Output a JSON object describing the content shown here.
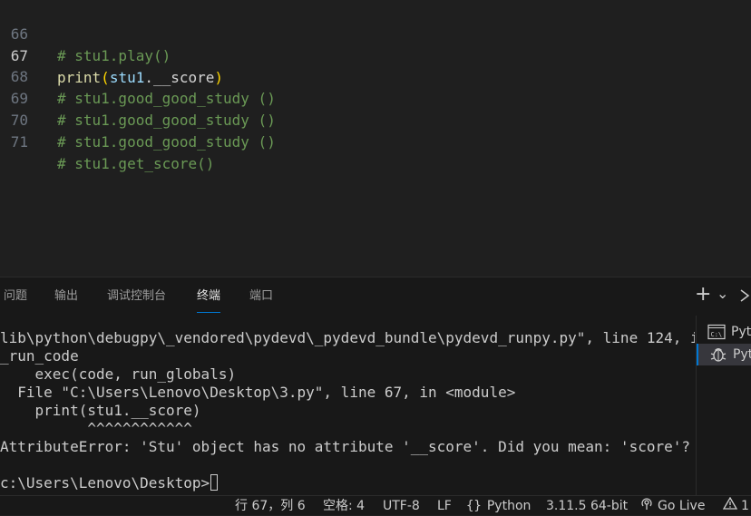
{
  "editor": {
    "lines": [
      {
        "num": "66",
        "text": "# stu1.play()"
      },
      {
        "num": "67",
        "fn": "print",
        "open": "(",
        "var": "stu1",
        "attr": ".__score",
        "close": ")"
      },
      {
        "num": "68",
        "text": "# stu1.good_good_study ()"
      },
      {
        "num": "69",
        "text": "# stu1.good_good_study ()"
      },
      {
        "num": "70",
        "text": "# stu1.good_good_study ()"
      },
      {
        "num": "71",
        "text": "# stu1.get_score()"
      }
    ]
  },
  "panel": {
    "tabs": [
      {
        "label": "问题"
      },
      {
        "label": "输出"
      },
      {
        "label": "调试控制台"
      },
      {
        "label": "终端"
      },
      {
        "label": "端口"
      }
    ],
    "active_tab": "终端",
    "actions": {
      "add": "+",
      "dropdown": "⌄"
    },
    "terminal_lines": [
      "lib\\python\\debugpy\\_vendored\\pydevd\\_pydevd_bundle\\pydevd_runpy.py\", line 124, in",
      "_run_code",
      "    exec(code, run_globals)",
      "  File \"C:\\Users\\Lenovo\\Desktop\\3.py\", line 67, in <module>",
      "    print(stu1.__score)",
      "          ^^^^^^^^^^^^",
      "AttributeError: 'Stu' object has no attribute '__score'. Did you mean: 'score'?",
      ""
    ],
    "prompt": "c:\\Users\\Lenovo\\Desktop>",
    "terminal_list": [
      {
        "label": "Pyt",
        "icon": "terminal-cmd-icon"
      },
      {
        "label": "Pyt",
        "icon": "debug-bug-icon"
      }
    ]
  },
  "statusbar": {
    "position": "行 67，列 6",
    "indent": "空格: 4",
    "encoding": "UTF-8",
    "eol": "LF",
    "language": "Python",
    "interpreter": "3.11.5 64-bit",
    "golive": "Go Live",
    "warnings": "1"
  },
  "colors": {
    "editor_bg": "#1f1f1f",
    "panel_bg": "#181818",
    "comment": "#6a9955",
    "accent": "#0078d4"
  }
}
